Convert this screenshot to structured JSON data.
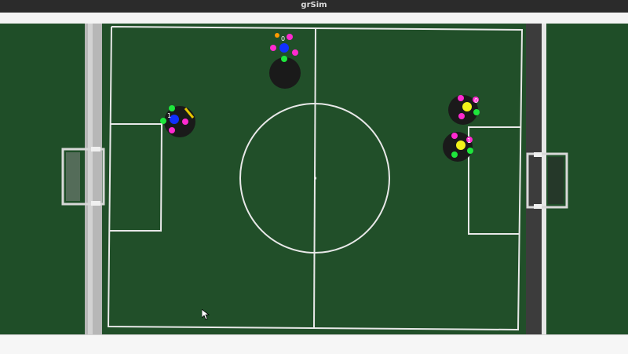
{
  "window": {
    "title": "grSim"
  },
  "colors": {
    "field": "#1e4d28",
    "line": "#e9e9e9",
    "wall_left": "#b9b9b9",
    "wall_right": "#3a3a3a",
    "blue_team": "#1030ff",
    "yellow_team": "#f2f21a",
    "pink_marker": "#ff2ad0",
    "green_marker": "#1ee63c",
    "robot_body": "#1a1a1a",
    "ball": "#ff9a00"
  },
  "robots": [
    {
      "team": "blue",
      "id": "1"
    },
    {
      "team": "blue",
      "id": "0"
    },
    {
      "team": "yellow",
      "id": "0"
    },
    {
      "team": "yellow",
      "id": "1"
    }
  ],
  "icons": {
    "cursor": "arrow-cursor-icon"
  }
}
